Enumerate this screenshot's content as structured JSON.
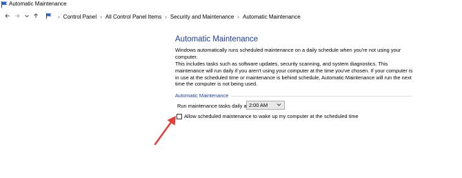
{
  "window": {
    "title": "Automatic Maintenance"
  },
  "addressbar": {
    "back_icon": "arrow-left-icon",
    "forward_icon": "arrow-right-icon",
    "recent_icon": "chevron-down-icon",
    "up_icon": "arrow-up-icon",
    "breadcrumbs": [
      "Control Panel",
      "All Control Panel Items",
      "Security and Maintenance",
      "Automatic Maintenance"
    ]
  },
  "main": {
    "title": "Automatic Maintenance",
    "intro": "Windows automatically runs scheduled maintenance on a daily schedule when you're not using your computer.",
    "details": "This includes tasks such as software updates, security scanning, and system diagnostics. This maintenance will run daily if you aren't using your computer at the time you've chosen. If your computer is in use at the scheduled time or maintenance is behind schedule, Automatic Maintenance will run the next time the computer is not being used.",
    "section_label": "Automatic Maintenance",
    "run_label": "Run maintenance tasks daily at",
    "time_value": "2:00 AM",
    "wake_label": "Allow scheduled maintenance to wake up my computer at the scheduled time",
    "wake_checked": false
  },
  "colors": {
    "heading": "#1e3c96",
    "annotation_arrow": "#e0403a"
  }
}
